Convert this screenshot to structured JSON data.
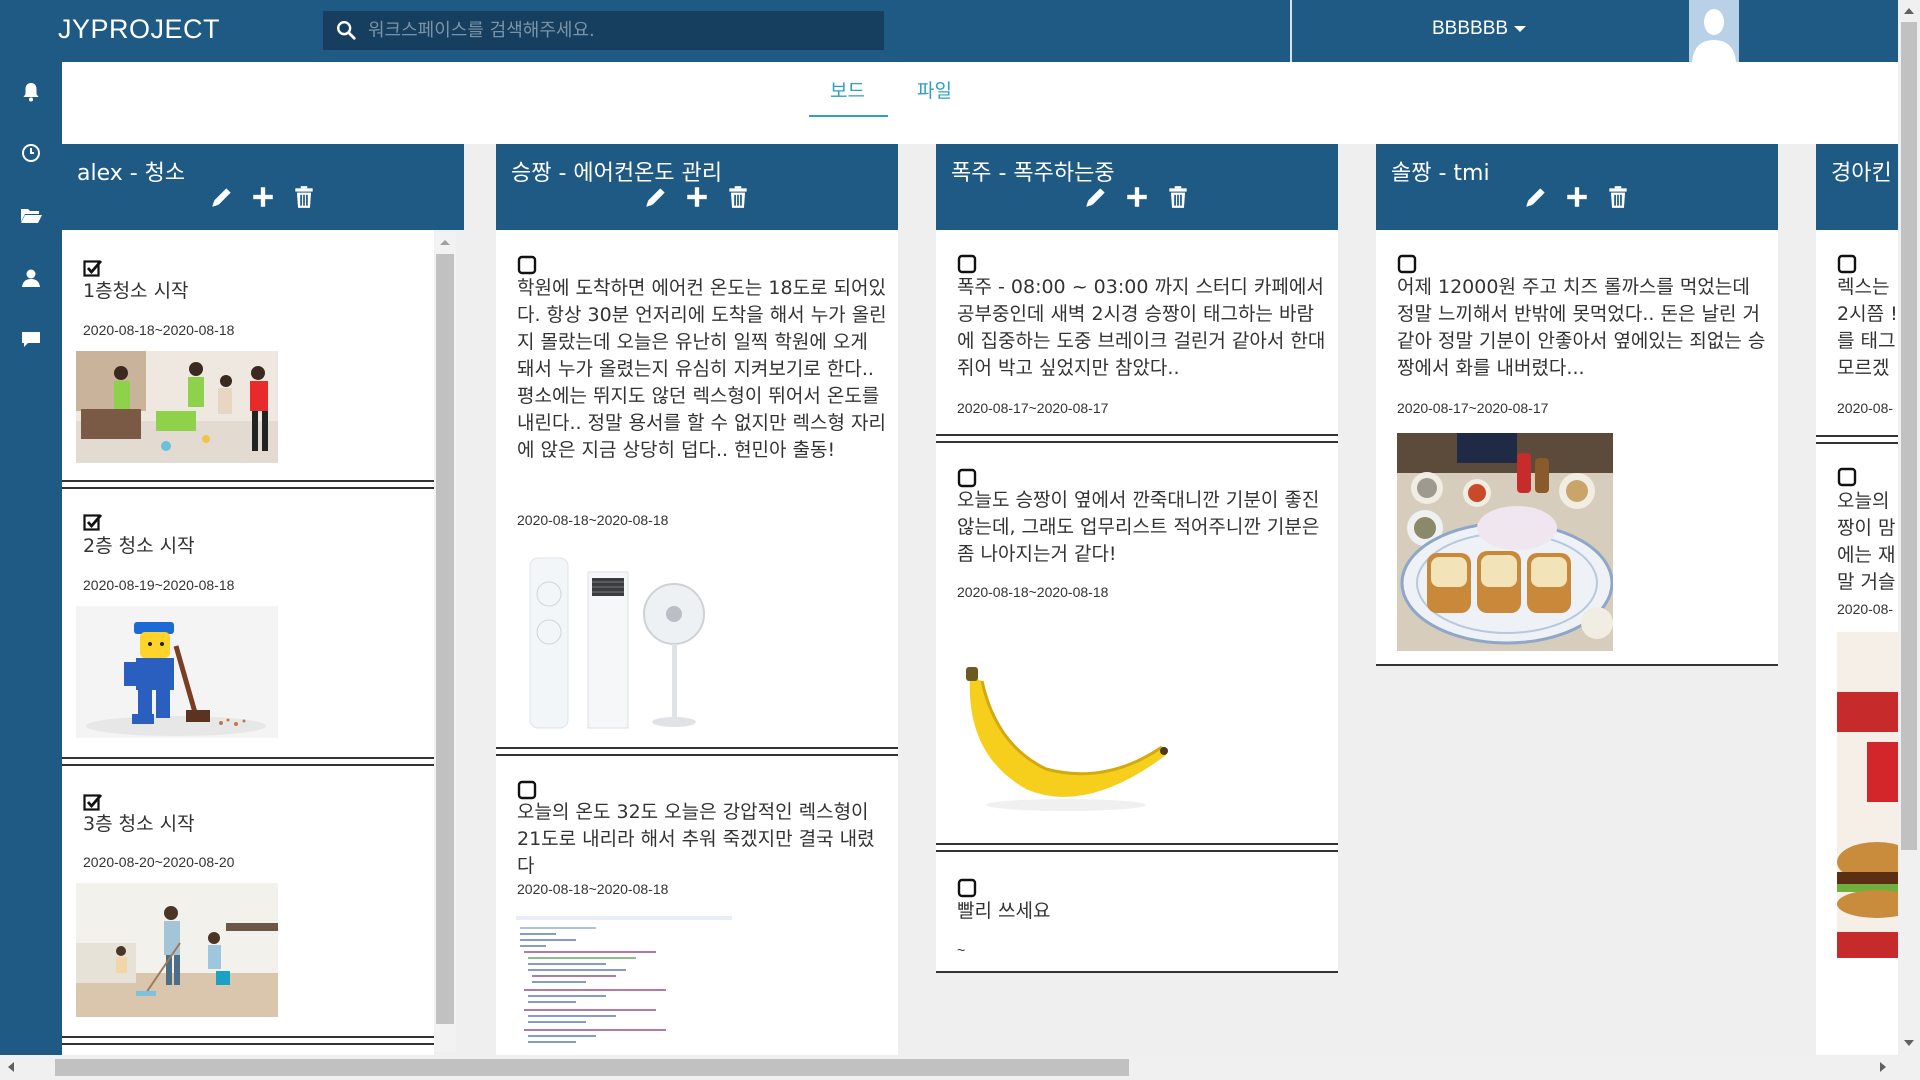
{
  "app": {
    "brand": "JYPROJECT",
    "search_placeholder": "워크스페이스를 검색해주세요.",
    "user_name": "BBBBBB"
  },
  "tabs": [
    {
      "label": "보드",
      "active": true
    },
    {
      "label": "파일",
      "active": false
    }
  ],
  "sidebar": [
    "bell-icon",
    "clock-icon",
    "folder-icon",
    "user-icon",
    "chat-icon"
  ],
  "columns": [
    {
      "title": "alex - 청소",
      "cards": [
        {
          "checked": true,
          "text": "1층청소 시작",
          "date": "2020-08-18~2020-08-18",
          "image": "people-cleaning-photo"
        },
        {
          "checked": true,
          "text": "2층 청소 시작",
          "date": "2020-08-19~2020-08-18",
          "image": "lego-janitor-photo"
        },
        {
          "checked": true,
          "text": "3층 청소 시작",
          "date": "2020-08-20~2020-08-20",
          "image": "family-cleaning-photo"
        }
      ]
    },
    {
      "title": "승짱 - 에어컨온도 관리",
      "cards": [
        {
          "checked": false,
          "text": "학원에 도착하면 에어컨 온도는 18도로 되어있다. 항상 30분 언저리에 도착을 해서 누가 올린지 몰랐는데 오늘은 유난히 일찍 학원에 오게 돼서 누가 올렸는지 유심히 지켜보기로 한다.. 평소에는 뛰지도 않던 렉스형이 뛰어서 온도를 내린다.. 정말 용서를 할 수 없지만 렉스형 자리에 앉은 지금 상당히 덥다.. 현민아 출동!",
          "date": "2020-08-18~2020-08-18",
          "image": "aircon-fan-photo"
        },
        {
          "checked": false,
          "text": "오늘의 온도 32도 오늘은 강압적인 렉스형이 21도로 내리라 해서 추워 죽겠지만 결국 내렸다",
          "date": "2020-08-18~2020-08-18",
          "image": "code-screenshot"
        }
      ]
    },
    {
      "title": "폭주 - 폭주하는중",
      "cards": [
        {
          "checked": false,
          "text": "폭주 - 08:00 ~ 03:00 까지 스터디 카페에서 공부중인데 새벽 2시경 승짱이 태그하는 바람에 집중하는 도중 브레이크 걸린거 같아서 한대 쥐어 박고 싶었지만 참았다..",
          "date": "2020-08-17~2020-08-17",
          "image": ""
        },
        {
          "checked": false,
          "text": "오늘도 승짱이 옆에서 깐죽대니깐 기분이 좋진 않는데, 그래도 업무리스트 적어주니깐 기분은 좀 나아지는거 같다!",
          "date": "2020-08-18~2020-08-18",
          "image": "banana-photo"
        },
        {
          "checked": false,
          "text": "빨리 쓰세요",
          "date": "~",
          "image": ""
        }
      ]
    },
    {
      "title": "솔짱 - tmi",
      "cards": [
        {
          "checked": false,
          "text": "어제 12000원 주고 치즈 롤까스를 먹었는데 정말 느끼해서 반밖에 못먹었다.. 돈은 날린 거 같아 정말 기분이 안좋아서 옆에있는 죄없는 승짱에서 화를 내버렸다...",
          "date": "2020-08-17~2020-08-17",
          "image": "tonkatsu-photo"
        }
      ]
    },
    {
      "title": "경아킨",
      "cards": [
        {
          "checked": false,
          "text": "렉스는\n2시쯤 !\n를 태그\n모르겠",
          "date": "2020-08-",
          "image": ""
        },
        {
          "checked": false,
          "text": "오늘의\n짱이 맘\n에는 재\n말 거슬",
          "date": "2020-08-",
          "image": "burger-ad-photo"
        }
      ]
    }
  ]
}
